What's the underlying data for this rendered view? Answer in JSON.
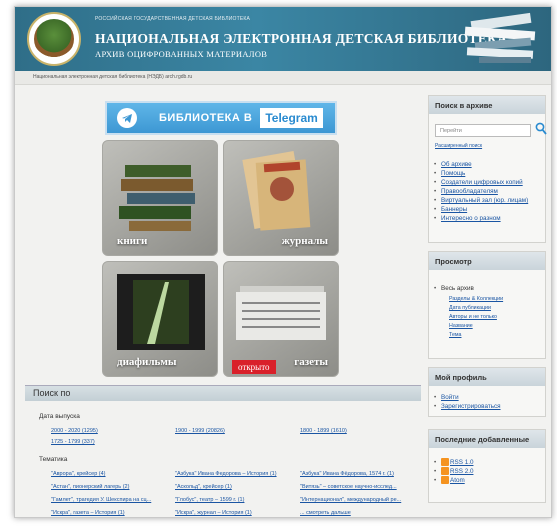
{
  "header": {
    "small_line": "РОССИЙСКАЯ ГОСУДАРСТВЕННАЯ ДЕТСКАЯ БИБЛИОТЕКА",
    "title": "НАЦИОНАЛЬНАЯ ЭЛЕКТРОННАЯ ДЕТСКАЯ БИБЛИОТЕКА",
    "subtitle": "АРХИВ ОЦИФРОВАННЫХ МАТЕРИАЛОВ"
  },
  "breadcrumb": "Национальная электронная детская библиотека (НЭДБ) arch.rgdb.ru",
  "telegram": {
    "text": "БИБЛИОТЕКА В",
    "brand": "Telegram"
  },
  "tiles": {
    "books": "книги",
    "magazines": "журналы",
    "filmstrips": "диафильмы",
    "newspapers": "газеты",
    "ribbon": "открыто"
  },
  "search_by": {
    "title": "Поиск по",
    "date_label": "Дата выпуска",
    "dates": [
      "2000 - 2020 (1295)",
      "1900 - 1999 (20826)",
      "1800 - 1899 (1610)",
      "1725 - 1799 (337)"
    ],
    "topics_label": "Тематика",
    "topics": [
      [
        "\"Аврора\", крейсер (4)",
        "\"Азбука\" Ивана Федорова – История (1)",
        "\"Азбука\" Ивана Фёдорова, 1574 г. (1)"
      ],
      [
        "\"Астан\", пионерский лагерь (2)",
        "\"Аскольд\", крейсер (1)",
        "\"Витязь\" – советское научно-исслед..."
      ],
      [
        "\"Гамлет\", трагедия У. Шекспира на сц...",
        "\"Глобус\", театр – 1599 г. (1)",
        "\"Интернационал\", международный ре..."
      ],
      [
        "\"Искра\", газета – История (1)",
        "\"Искра\", журнал – История (1)",
        "... смотреть дальше"
      ]
    ]
  },
  "sidebar": {
    "search": {
      "title": "Поиск в архиве",
      "placeholder": "Перейти",
      "advanced": "Расширенный поиск"
    },
    "links": [
      "Об архиве",
      "Помощь",
      "Создатели цифровых копий",
      "Правообладателям",
      "Виртуальный зал (юр. лицам)",
      "Баннеры",
      "Интересно о разном"
    ],
    "browse": {
      "title": "Просмотр",
      "all": "Весь архив",
      "items": [
        "Разделы & Коллекции",
        "Дата публикации",
        "Авторы и не только",
        "Название",
        "Тема"
      ]
    },
    "profile": {
      "title": "Мой профиль",
      "items": [
        "Войти",
        "Зарегистрироваться"
      ]
    },
    "recent": {
      "title": "Последние добавленные",
      "items": [
        "RSS 1.0",
        "RSS 2.0",
        "Atom"
      ]
    }
  },
  "colors": {
    "header": "#3b86a4",
    "link": "#1a55a3",
    "telegram": "#3d97d3",
    "ribbon": "#d9202a"
  }
}
